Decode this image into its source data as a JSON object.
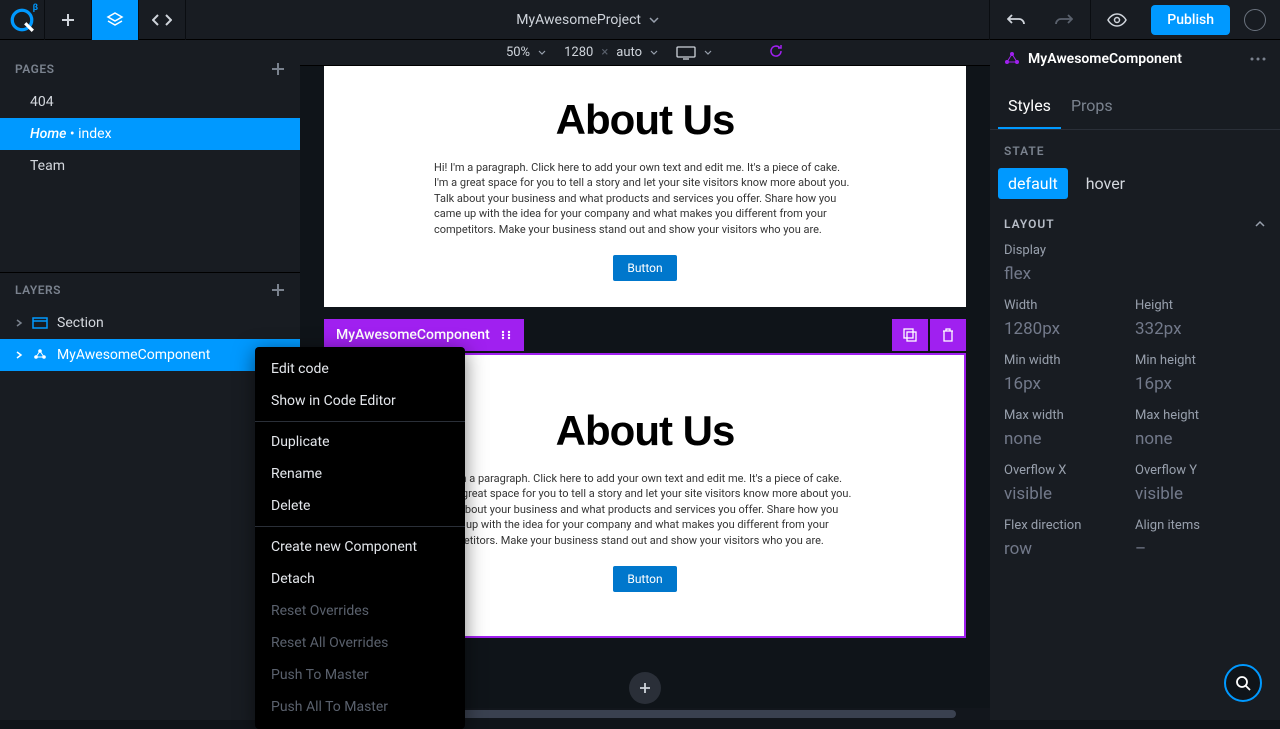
{
  "topbar": {
    "project_name": "MyAwesomeProject",
    "publish_label": "Publish",
    "beta": "β"
  },
  "sidebar": {
    "pages_label": "PAGES",
    "layers_label": "LAYERS",
    "pages": [
      {
        "label": "404"
      },
      {
        "label_prefix": "Home",
        "label_suffix": " • index"
      },
      {
        "label": "Team"
      }
    ],
    "layers": [
      {
        "label": "Section"
      },
      {
        "label": "MyAwesomeComponent"
      }
    ]
  },
  "ruler": {
    "zoom": "50%",
    "width": "1280",
    "sep": "×",
    "height": "auto"
  },
  "canvas": {
    "title": "About Us",
    "paragraph": "Hi! I'm a paragraph. Click here to add your own text and edit me. It's a piece of cake. I'm a great space for you to tell a story and let your site visitors know more about you. Talk about your business and what products and services you offer. Share how you came up with the idea for your company and what makes you different from your competitors. Make your business stand out and show your visitors who you are.",
    "button": "Button",
    "component_name": "MyAwesomeComponent"
  },
  "context_menu": {
    "items": [
      {
        "label": "Edit code",
        "disabled": false
      },
      {
        "label": "Show in Code Editor",
        "disabled": false
      },
      {
        "divider": true
      },
      {
        "label": "Duplicate",
        "disabled": false
      },
      {
        "label": "Rename",
        "disabled": false
      },
      {
        "label": "Delete",
        "disabled": false
      },
      {
        "divider": true
      },
      {
        "label": "Create new Component",
        "disabled": false
      },
      {
        "label": "Detach",
        "disabled": false
      },
      {
        "label": "Reset Overrides",
        "disabled": true
      },
      {
        "label": "Reset All Overrides",
        "disabled": true
      },
      {
        "label": "Push To Master",
        "disabled": true
      },
      {
        "label": "Push All To Master",
        "disabled": true
      }
    ]
  },
  "right_panel": {
    "component_name": "MyAwesomeComponent",
    "tabs": {
      "styles": "Styles",
      "props": "Props"
    },
    "state_label": "STATE",
    "states": {
      "default": "default",
      "hover": "hover"
    },
    "layout_label": "LAYOUT",
    "props": {
      "display": {
        "label": "Display",
        "value": "flex"
      },
      "width": {
        "label": "Width",
        "value": "1280px"
      },
      "height": {
        "label": "Height",
        "value": "332px"
      },
      "min_width": {
        "label": "Min width",
        "value": "16px"
      },
      "min_height": {
        "label": "Min height",
        "value": "16px"
      },
      "max_width": {
        "label": "Max width",
        "value": "none"
      },
      "max_height": {
        "label": "Max height",
        "value": "none"
      },
      "overflow_x": {
        "label": "Overflow X",
        "value": "visible"
      },
      "overflow_y": {
        "label": "Overflow Y",
        "value": "visible"
      },
      "flex_direction": {
        "label": "Flex direction",
        "value": "row"
      },
      "align_items": {
        "label": "Align items",
        "value": "–"
      }
    }
  }
}
